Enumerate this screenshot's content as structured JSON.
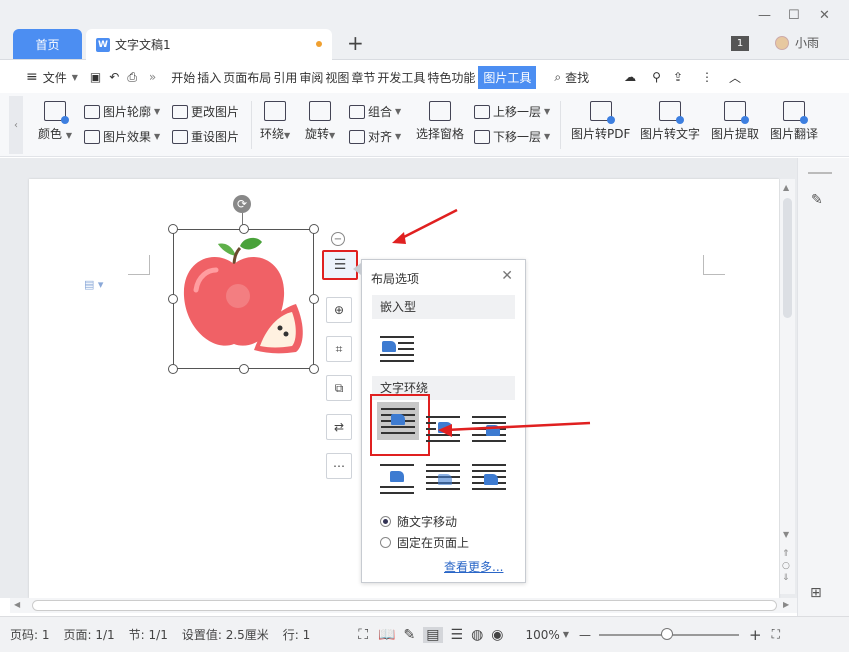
{
  "tabs": {
    "home": "首页",
    "doc": "文字文稿1",
    "add": "+"
  },
  "window": {
    "minimize": "—",
    "maximize": "☐",
    "close": "✕",
    "badge": "1",
    "user": "小雨"
  },
  "menu": {
    "file": "文件",
    "items": [
      "开始",
      "插入",
      "页面布局",
      "引用",
      "审阅",
      "视图",
      "章节",
      "开发工具",
      "特色功能"
    ],
    "active": "图片工具",
    "search": "查找",
    "more": "»"
  },
  "ribbon": {
    "color": "颜色",
    "outline": "图片轮廓",
    "effect": "图片效果",
    "change": "更改图片",
    "reset": "重设图片",
    "wrap": "环绕",
    "rotate": "旋转",
    "group": "组合",
    "align": "对齐",
    "pane": "选择窗格",
    "up": "上移一层",
    "down": "下移一层",
    "to_pdf": "图片转PDF",
    "to_text": "图片转文字",
    "extract": "图片提取",
    "translate": "图片翻译"
  },
  "popup": {
    "title": "布局选项",
    "section_inline": "嵌入型",
    "section_wrap": "文字环绕",
    "radio_move": "随文字移动",
    "radio_fixed": "固定在页面上",
    "more": "查看更多..."
  },
  "status": {
    "page_num": "页码: 1",
    "pages": "页面: 1/1",
    "section": "节: 1/1",
    "setting": "设置值: 2.5厘米",
    "row": "行: 1",
    "zoom": "100%",
    "minus": "—",
    "plus": "+"
  },
  "colors": {
    "accent": "#4c8ef2",
    "arrow": "#e02020"
  },
  "icons": [
    "rotate-icon",
    "layout-icon",
    "zoom-icon",
    "crop-icon",
    "convert-icon",
    "replace-icon",
    "more-icon",
    "apple-image"
  ]
}
